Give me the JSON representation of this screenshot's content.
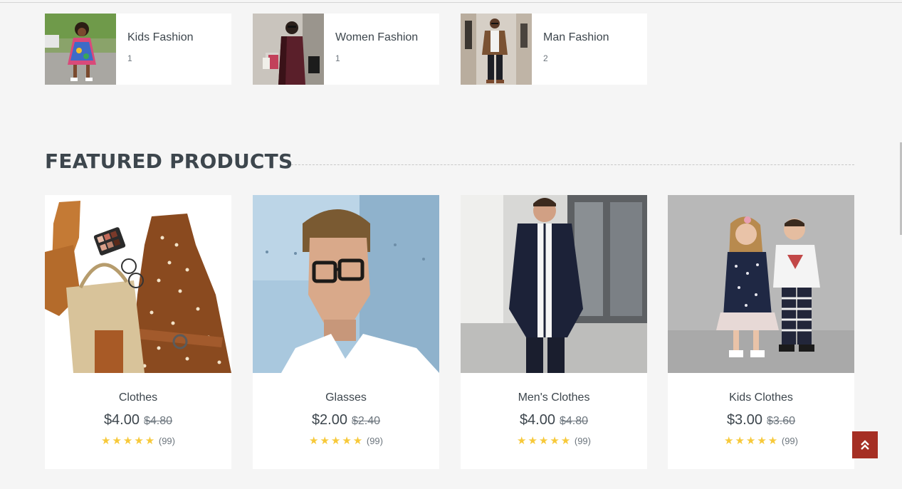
{
  "categories": [
    {
      "name": "Kids Fashion",
      "count": "1",
      "thumb_icon": "kids-fashion-photo"
    },
    {
      "name": "Women Fashion",
      "count": "1",
      "thumb_icon": "women-fashion-photo"
    },
    {
      "name": "Man Fashion",
      "count": "2",
      "thumb_icon": "man-fashion-photo"
    }
  ],
  "featured": {
    "title": "FEATURED PRODUCTS"
  },
  "products": [
    {
      "name": "Clothes",
      "price": "$4.00",
      "old_price": "$4.80",
      "stars": "★★★★★",
      "reviews": "(99)"
    },
    {
      "name": "Glasses",
      "price": "$2.00",
      "old_price": "$2.40",
      "stars": "★★★★★",
      "reviews": "(99)"
    },
    {
      "name": "Men's Clothes",
      "price": "$4.00",
      "old_price": "$4.80",
      "stars": "★★★★★",
      "reviews": "(99)"
    },
    {
      "name": "Kids Clothes",
      "price": "$3.00",
      "old_price": "$3.60",
      "stars": "★★★★★",
      "reviews": "(99)"
    }
  ],
  "colors": {
    "accent": "#a52f24",
    "star": "#f7c93a",
    "text": "#3d464d",
    "background": "#f5f5f5"
  },
  "scroll_top_icon": "double-chevron-up-icon"
}
